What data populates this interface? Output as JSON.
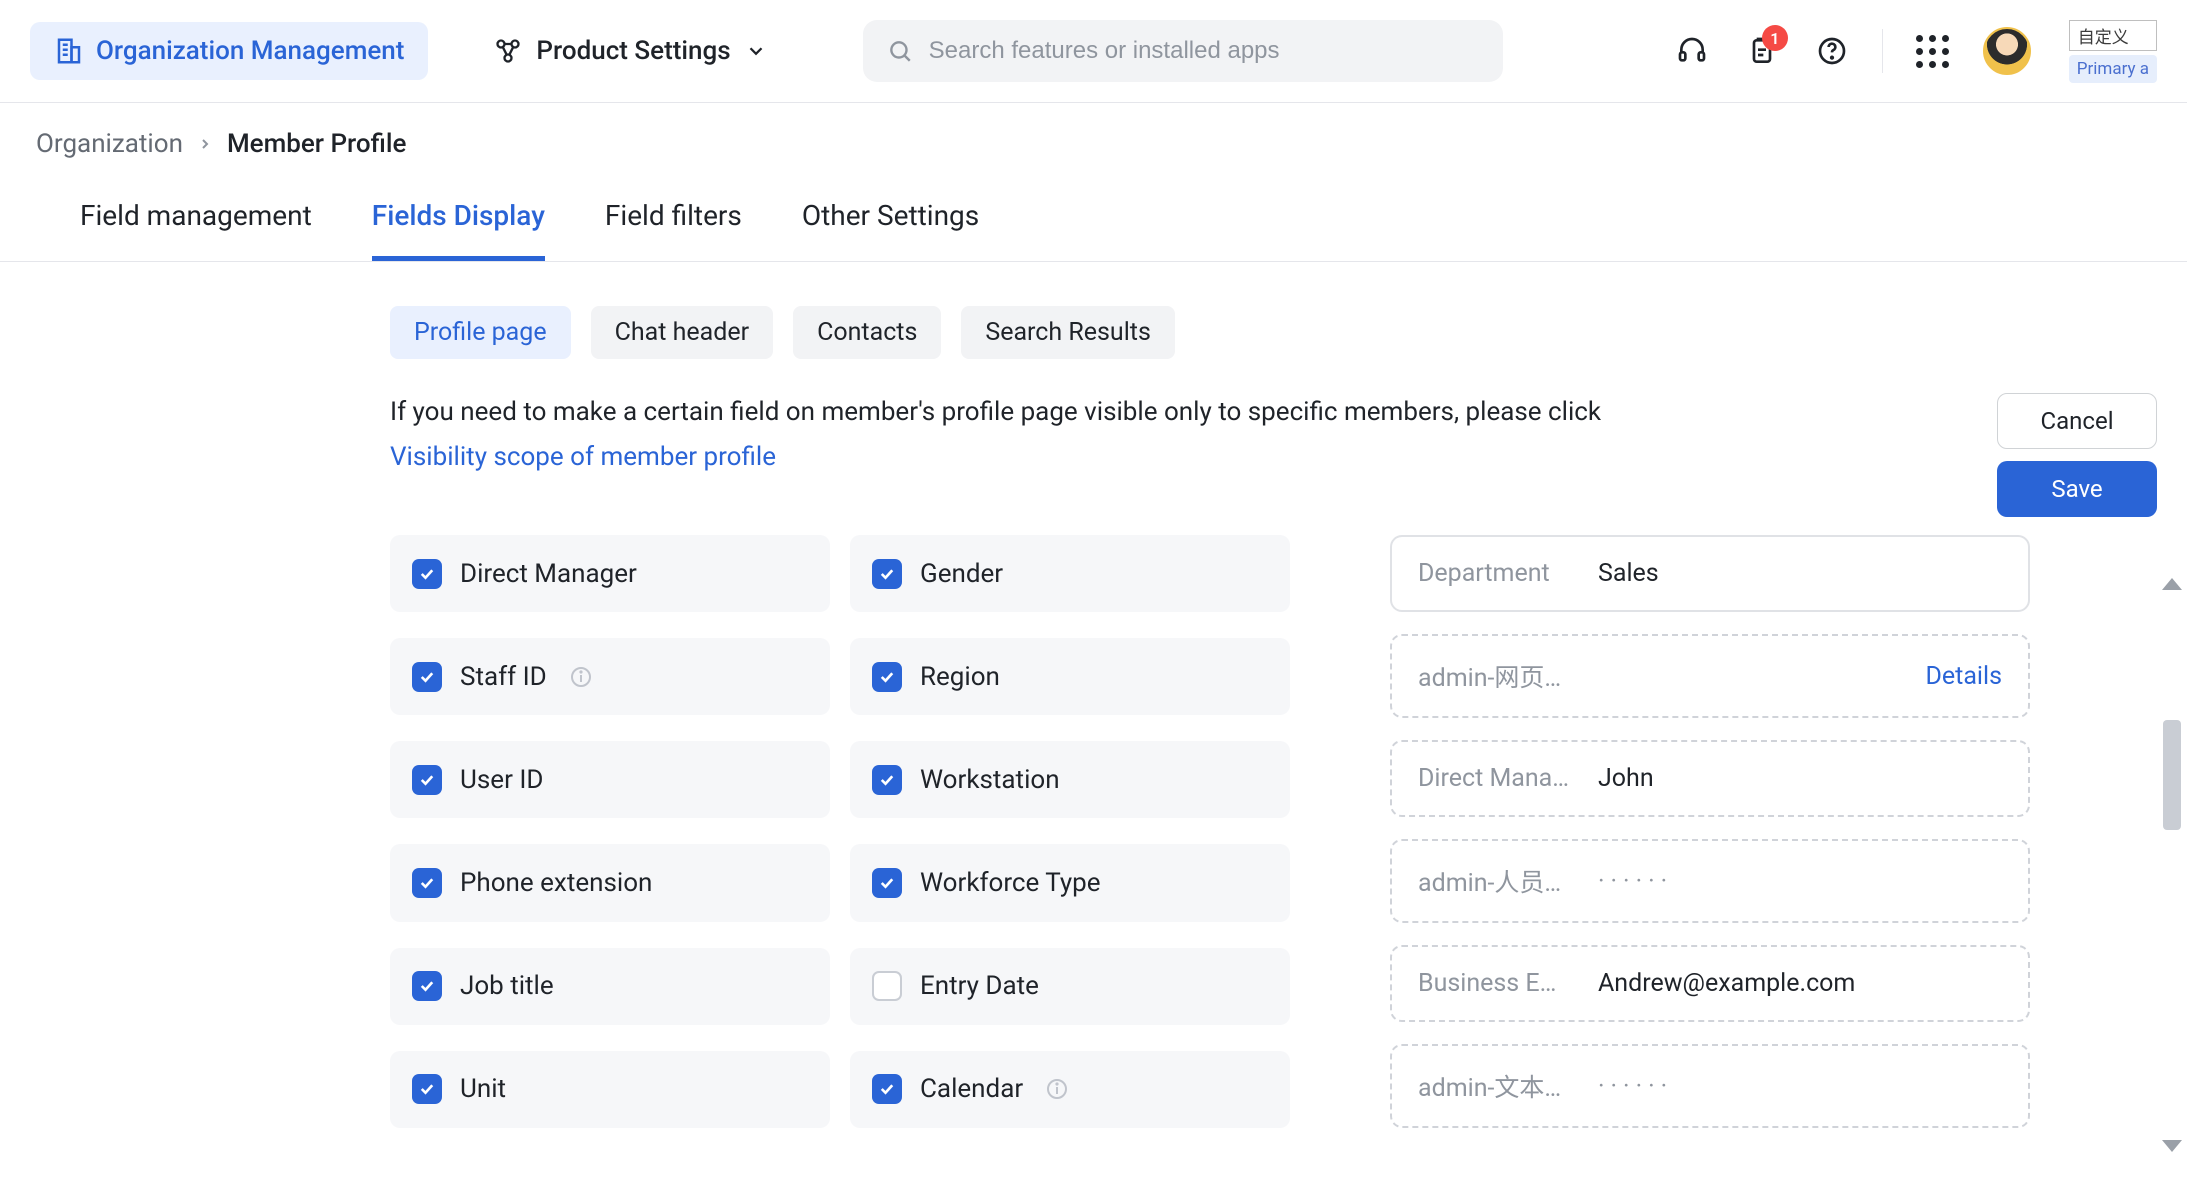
{
  "header": {
    "org_label": "Organization Management",
    "product_settings": "Product Settings",
    "search_placeholder": "Search features or installed apps",
    "badge_count": "1",
    "corner_tag": "自定义",
    "corner_badge": "Primary a"
  },
  "breadcrumb": {
    "root": "Organization",
    "current": "Member Profile"
  },
  "tabs": [
    {
      "label": "Field management",
      "active": false
    },
    {
      "label": "Fields Display",
      "active": true
    },
    {
      "label": "Field filters",
      "active": false
    },
    {
      "label": "Other Settings",
      "active": false
    }
  ],
  "subtabs": [
    {
      "label": "Profile page",
      "active": true
    },
    {
      "label": "Chat header",
      "active": false
    },
    {
      "label": "Contacts",
      "active": false
    },
    {
      "label": "Search Results",
      "active": false
    }
  ],
  "help": {
    "text": "If you need to make a certain field on member's profile page visible only to specific members, please click",
    "link": "Visibility scope of member profile"
  },
  "actions": {
    "cancel": "Cancel",
    "save": "Save"
  },
  "fields_left": [
    {
      "label": "Direct Manager",
      "checked": true,
      "info": false
    },
    {
      "label": "Staff ID",
      "checked": true,
      "info": true
    },
    {
      "label": "User ID",
      "checked": true,
      "info": false
    },
    {
      "label": "Phone extension",
      "checked": true,
      "info": false
    },
    {
      "label": "Job title",
      "checked": true,
      "info": false
    },
    {
      "label": "Unit",
      "checked": true,
      "info": false
    }
  ],
  "fields_right": [
    {
      "label": "Gender",
      "checked": true,
      "info": false
    },
    {
      "label": "Region",
      "checked": true,
      "info": false
    },
    {
      "label": "Workstation",
      "checked": true,
      "info": false
    },
    {
      "label": "Workforce Type",
      "checked": true,
      "info": false
    },
    {
      "label": "Entry Date",
      "checked": false,
      "info": false
    },
    {
      "label": "Calendar",
      "checked": true,
      "info": true
    }
  ],
  "preview": [
    {
      "label": "Department",
      "value": "Sales",
      "solid": true
    },
    {
      "label": "admin-网页…",
      "value": "",
      "link": "Details"
    },
    {
      "label": "Direct Mana…",
      "value": "John"
    },
    {
      "label": "admin-人员…",
      "value": "······",
      "dots": true
    },
    {
      "label": "Business E…",
      "value": "Andrew@example.com"
    },
    {
      "label": "admin-文本…",
      "value": "······",
      "dots": true
    }
  ]
}
